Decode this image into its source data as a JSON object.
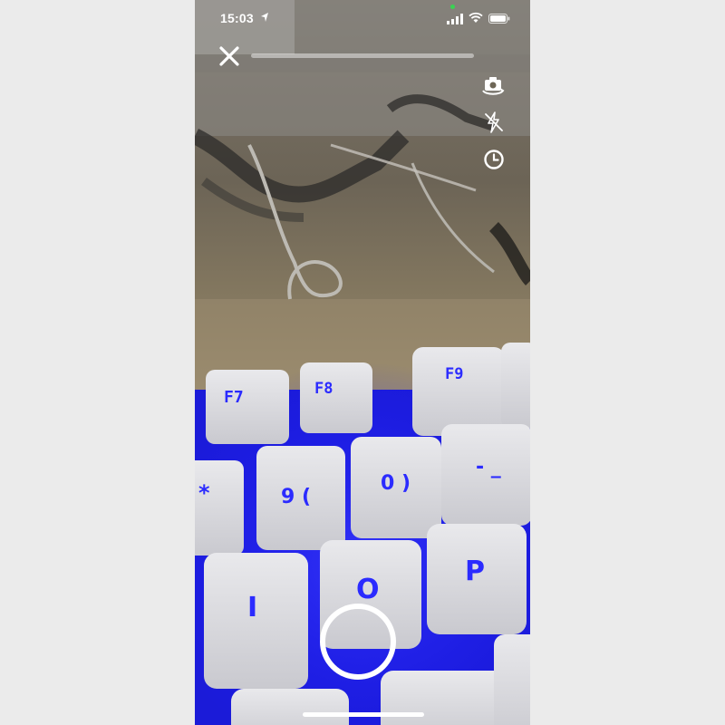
{
  "status_bar": {
    "time": "15:03",
    "location_icon": "location-arrow-icon",
    "signal_icon": "cellular-signal-icon",
    "wifi_icon": "wifi-icon",
    "battery_icon": "battery-icon",
    "camera_in_use_indicator_color": "#39d353"
  },
  "camera": {
    "close_icon": "close-icon",
    "progress_fraction": 0.0,
    "controls": [
      {
        "id": "flip",
        "icon": "flip-camera-icon"
      },
      {
        "id": "flash",
        "icon": "flash-off-icon"
      },
      {
        "id": "timer",
        "icon": "timer-icon"
      }
    ],
    "shutter_icon": "shutter-ring",
    "accent_color": "#ffffff",
    "key_backlight_color": "#2b2bff"
  },
  "viewfinder_scene": {
    "keys": [
      "F7",
      "F8",
      "F9",
      "*",
      "9 (",
      "0 )",
      "- _",
      "I",
      "O",
      "P"
    ]
  }
}
